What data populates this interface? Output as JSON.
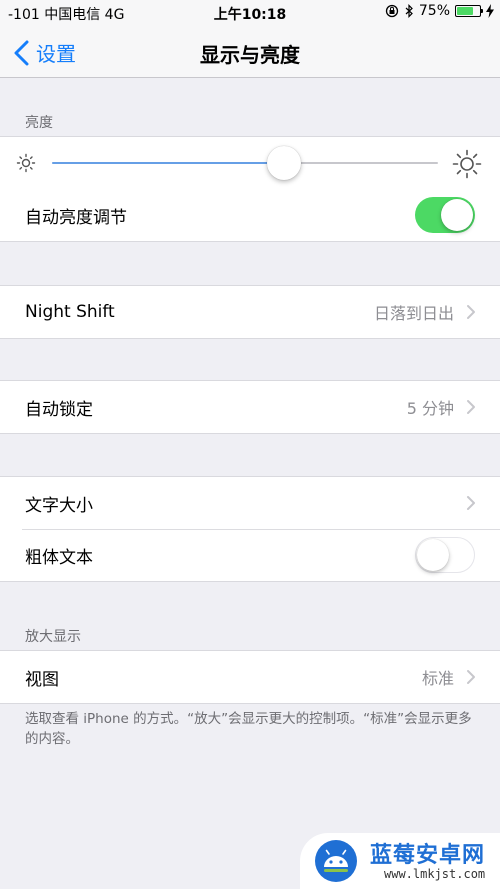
{
  "status_bar": {
    "carrier": "-101 中国电信   4G",
    "time": "上午10:18",
    "battery_percent": "75%",
    "battery_level": 0.75
  },
  "nav": {
    "back_label": "设置",
    "title": "显示与亮度"
  },
  "brightness_section": {
    "header": "亮度",
    "slider_value": 0.6,
    "auto_brightness_label": "自动亮度调节",
    "auto_brightness_on": true
  },
  "night_shift": {
    "label": "Night Shift",
    "detail": "日落到日出"
  },
  "auto_lock": {
    "label": "自动锁定",
    "detail": "5 分钟"
  },
  "text_section": {
    "text_size_label": "文字大小",
    "bold_text_label": "粗体文本",
    "bold_text_on": false
  },
  "zoom_section": {
    "header": "放大显示",
    "view_label": "视图",
    "view_detail": "标准",
    "footer": "选取查看 iPhone 的方式。“放大”会显示更大的控制项。“标准”会显示更多的内容。"
  },
  "watermark": {
    "title": "蓝莓安卓网",
    "url": "www.lmkjst.com"
  },
  "colors": {
    "accent": "#157efb",
    "toggle_on": "#4cd964",
    "background": "#efeff4"
  }
}
